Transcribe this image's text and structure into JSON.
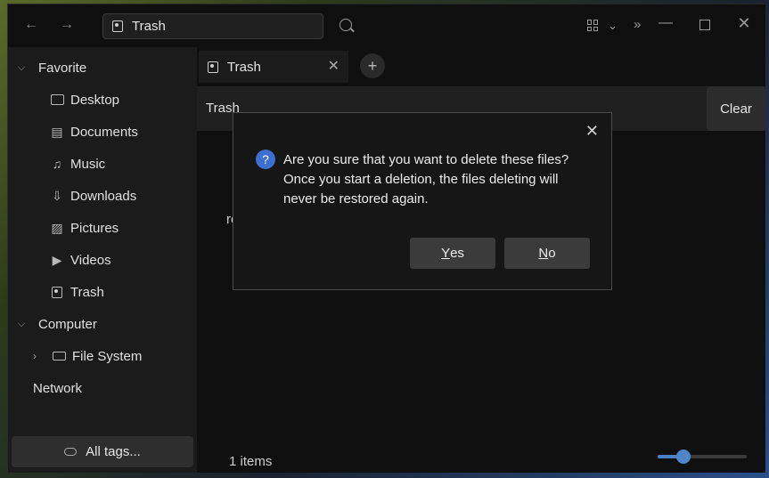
{
  "toolbar": {
    "address": "Trash"
  },
  "sidebar": {
    "favorite": "Favorite",
    "items": [
      {
        "label": "Desktop"
      },
      {
        "label": "Documents"
      },
      {
        "label": "Music"
      },
      {
        "label": "Downloads"
      },
      {
        "label": "Pictures"
      },
      {
        "label": "Videos"
      },
      {
        "label": "Trash"
      }
    ],
    "computer": "Computer",
    "file_system": "File System",
    "network": "Network",
    "all_tags": "All tags..."
  },
  "main": {
    "tab_label": "Trash",
    "header_title": "Trash",
    "clear_label": "Clear",
    "file_label": "re",
    "status": "1 items",
    "zoom_fraction": 0.29
  },
  "dialog": {
    "message": "Are you sure that you want to delete these files? Once you start a deletion, the files deleting will never be restored again.",
    "yes_mnemonic": "Y",
    "yes_rest": "es",
    "no_mnemonic": "N",
    "no_rest": "o"
  },
  "colors": {
    "accent": "#3d6fd0",
    "slider": "#4f86c8"
  }
}
